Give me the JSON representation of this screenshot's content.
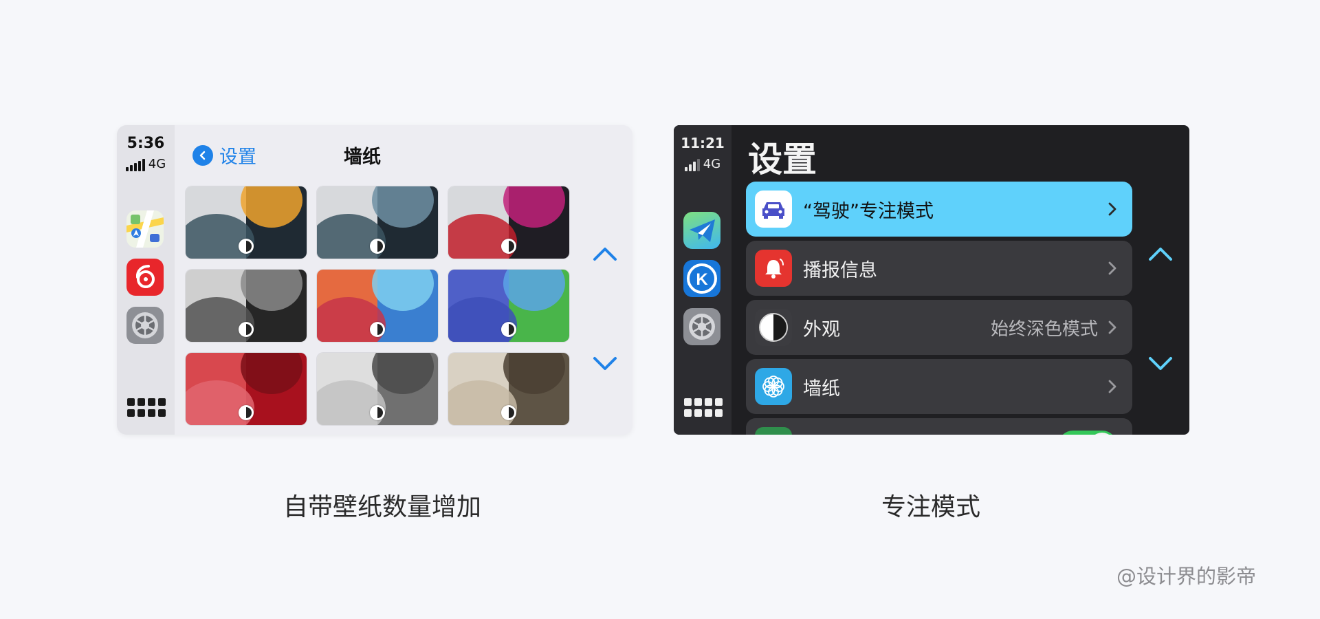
{
  "left_panel": {
    "status": {
      "time": "5:36",
      "network": "4G"
    },
    "nav": {
      "back_label": "设置",
      "title": "墙纸"
    },
    "wallpapers": [
      {
        "light": "#d7d9dc",
        "dark": "#1f2a33",
        "blob1": "#3c5562",
        "blob2": "#f0a32e"
      },
      {
        "light": "#d7d9dc",
        "dark": "#1f2a33",
        "blob1": "#3c5562",
        "blob2": "#6f8fa3"
      },
      {
        "light": "#d7d9dc",
        "dark": "#1f1d24",
        "blob1": "#c21e2b",
        "blob2": "#c2217a"
      },
      {
        "light": "#cfcfcf",
        "dark": "#262626",
        "blob1": "#545454",
        "blob2": "#8a8a8a"
      },
      {
        "light": "#e56a40",
        "dark": "#3a7fd0",
        "blob1": "#c7354a",
        "blob2": "#7fcff0"
      },
      {
        "light": "#4f60c8",
        "dark": "#49b54a",
        "blob1": "#3d4fb8",
        "blob2": "#5aa5e6"
      },
      {
        "light": "#d8484e",
        "dark": "#a8111e",
        "blob1": "#e26670",
        "blob2": "#7a0f18"
      },
      {
        "light": "#dedede",
        "dark": "#707070",
        "blob1": "#c2c2c2",
        "blob2": "#4a4a4a"
      },
      {
        "light": "#d9d1c3",
        "dark": "#5e5445",
        "blob1": "#c7bba6",
        "blob2": "#4a4033"
      }
    ]
  },
  "right_panel": {
    "status": {
      "time": "11:21",
      "network": "4G"
    },
    "title": "设置",
    "rows": [
      {
        "label": "“驾驶”专注模式",
        "value": ""
      },
      {
        "label": "播报信息",
        "value": ""
      },
      {
        "label": "外观",
        "value": "始终深色模式"
      },
      {
        "label": "墙纸",
        "value": ""
      }
    ]
  },
  "captions": {
    "left": "自带壁纸数量增加",
    "right": "专注模式"
  },
  "credit": "@设计界的影帝",
  "colors": {
    "accent_blue": "#1f82e8",
    "carplay_cyan": "#5fd1fb",
    "dark_bg": "#1f1f22"
  }
}
